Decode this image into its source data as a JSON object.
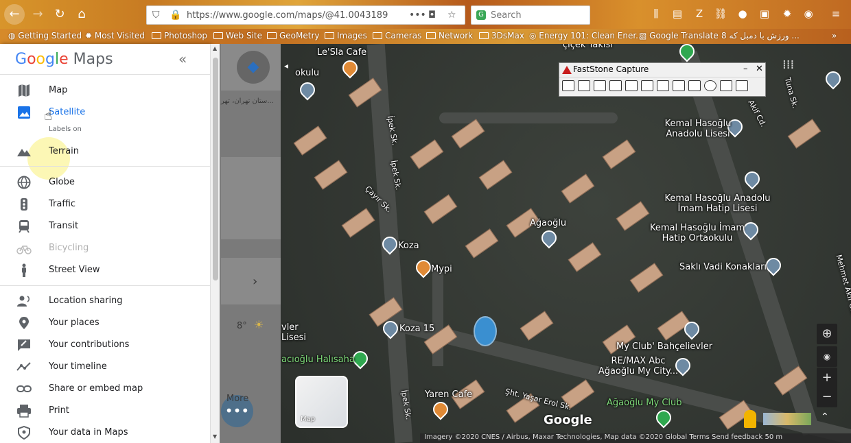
{
  "browser": {
    "url": "https://www.google.com/maps/@41.0043189",
    "search_placeholder": "Search",
    "bookmarks": [
      "Getting Started",
      "Most Visited",
      "Photoshop",
      "Web Site",
      "GeoMetry",
      "Images",
      "Cameras",
      "Network",
      "3DsMax",
      "Energy 101: Clean Ener...",
      "Google Translate",
      "8 ورزش با دمبل که ..."
    ]
  },
  "menu": {
    "brand": {
      "google": "Google",
      "maps": "Maps"
    },
    "collapse_label": "«",
    "labels_on": "Labels on",
    "items": [
      {
        "label": "Map",
        "icon": "map-icon"
      },
      {
        "label": "Satellite",
        "icon": "satellite-icon"
      },
      {
        "label": "Terrain",
        "icon": "terrain-icon"
      },
      {
        "label": "Globe",
        "icon": "globe-icon"
      },
      {
        "label": "Traffic",
        "icon": "traffic-icon"
      },
      {
        "label": "Transit",
        "icon": "transit-icon"
      },
      {
        "label": "Bicycling",
        "icon": "bicycle-icon"
      },
      {
        "label": "Street View",
        "icon": "pegman-icon"
      },
      {
        "label": "Location sharing",
        "icon": "location-sharing-icon"
      },
      {
        "label": "Your places",
        "icon": "place-pin-icon"
      },
      {
        "label": "Your contributions",
        "icon": "contributions-icon"
      },
      {
        "label": "Your timeline",
        "icon": "timeline-icon"
      },
      {
        "label": "Share or embed map",
        "icon": "link-icon"
      },
      {
        "label": "Print",
        "icon": "print-icon"
      },
      {
        "label": "Your data in Maps",
        "icon": "shield-icon"
      }
    ]
  },
  "panel": {
    "persian_text": "ستان تهران، تهر...",
    "temperature": "8°",
    "more_label": "More"
  },
  "faststone": {
    "title": "FastStone Capture"
  },
  "map": {
    "minimap_label": "Map",
    "brand": "Google",
    "footer": "Imagery ©2020 CNES / Airbus, Maxar Technologies, Map data ©2020    Global    Terms    Send feedback    50 m",
    "places": [
      {
        "name": "Le'Sla Cafe"
      },
      {
        "name": "Ağaoğlu"
      },
      {
        "name": "Koza"
      },
      {
        "name": "Mypi"
      },
      {
        "name": "Koza 15"
      },
      {
        "name": "Yaren Cafe"
      },
      {
        "name": "Kemal Hasoğlu Anadolu Lisesi"
      },
      {
        "name": "Kemal Hasoğlu Anadolu İmam Hatip Lisesi"
      },
      {
        "name": "Kemal Hasoğlu İmam Hatip Ortaokulu"
      },
      {
        "name": "Saklı Vadi Konakları"
      },
      {
        "name": "My Club' Bahçelievler"
      },
      {
        "name": "RE/MAX Abc Ağaoğlu My City..."
      },
      {
        "name": "Ağaoğlu My Club"
      },
      {
        "name": "acıoğlu Halısaha"
      },
      {
        "name": "vler Lisesi"
      },
      {
        "name": "okulu"
      },
      {
        "name": "çiçek Takısı"
      }
    ],
    "streets": [
      "İpek Sk.",
      "Çayır Sk.",
      "Şht. Yaşar Erol Sk.",
      "Tuna Sk.",
      "Mehmet Akif Cd.",
      "Akif Cd."
    ]
  }
}
